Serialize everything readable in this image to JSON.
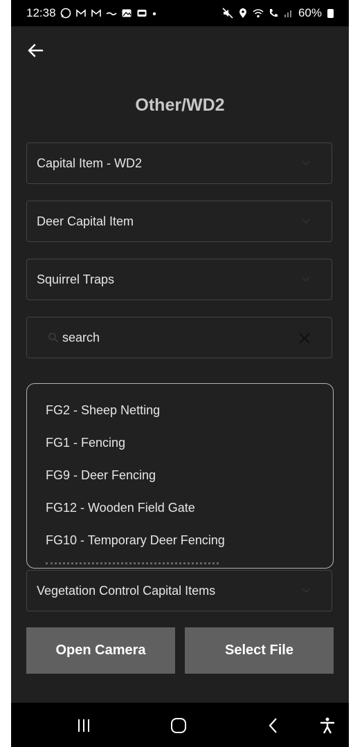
{
  "status_bar": {
    "time": "12:38",
    "battery": "60%",
    "left_icons": [
      "whatsapp-icon",
      "gmail-icon",
      "gmail-icon",
      "wave-icon",
      "gallery-icon",
      "card-icon",
      "dot-icon"
    ],
    "right_icons": [
      "mute-icon",
      "location-icon",
      "wifi-icon",
      "call-icon",
      "signal-icon",
      "battery-icon"
    ]
  },
  "header": {
    "back_icon": "arrow-left-icon",
    "title": "Other/WD2"
  },
  "fields": {
    "capital_item": "Capital Item - WD2",
    "deer_capital": "Deer Capital Item",
    "squirrel": "Squirrel Traps",
    "vegetation": "Vegetation Control Capital Items"
  },
  "search": {
    "placeholder": "search"
  },
  "dropdown": {
    "items": [
      "FG2 - Sheep Netting",
      "FG1 - Fencing",
      "FG9 - Deer Fencing",
      "FG12 - Wooden Field Gate",
      "FG10 - Temporary Deer Fencing"
    ]
  },
  "buttons": {
    "open_camera": "Open Camera",
    "select_file": "Select File"
  },
  "colors": {
    "background": "#202020",
    "field_border": "#444444",
    "button": "#606060",
    "text": "#e6e6e6"
  }
}
